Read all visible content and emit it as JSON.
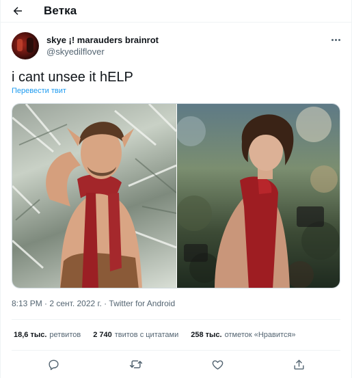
{
  "header": {
    "title": "Ветка",
    "back_icon": "arrow-left-icon"
  },
  "tweet": {
    "author": {
      "display_name": "skye ¡! marauders brainrot",
      "handle": "@skyedilflover",
      "avatar": "avatar-image"
    },
    "text": "i cant unsee it hELP",
    "translate_label": "Перевести твит",
    "media": [
      {
        "name": "media-image-left",
        "kind": "photo"
      },
      {
        "name": "media-image-right",
        "kind": "photo"
      }
    ],
    "timestamp": "8:13 PM · 2 сент. 2022 г. · Twitter for Android"
  },
  "stats": {
    "retweets_count": "18,6 тыс.",
    "retweets_label": "ретвитов",
    "quotes_count": "2 740",
    "quotes_label": "твитов с цитатами",
    "likes_count": "258 тыс.",
    "likes_label": "отметок «Нравится»"
  },
  "actions": [
    {
      "name": "reply-icon"
    },
    {
      "name": "retweet-icon"
    },
    {
      "name": "like-icon"
    },
    {
      "name": "share-icon"
    }
  ],
  "colors": {
    "text": "#0f1419",
    "secondary": "#536471",
    "accent": "#1d9bf0",
    "divider": "#eff3f4"
  }
}
